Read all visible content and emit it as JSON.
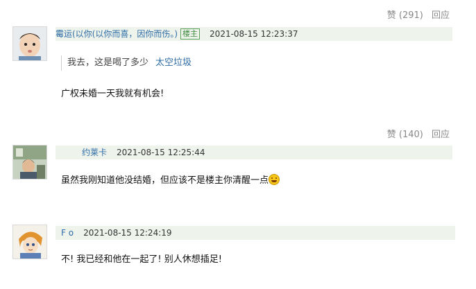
{
  "comments": [
    {
      "actions": {
        "like": "赞 (291)",
        "reply": "回应"
      },
      "user": "霉运(以你(以你而喜，因你而伤。)",
      "owner_badge": "楼主",
      "time": "2021-08-15 12:23:37",
      "quote": {
        "text": "我去，这是喝了多少",
        "author": "太空垃圾"
      },
      "content": "广权未婚一天我就有机会!"
    },
    {
      "actions": {
        "like": "赞 (140)",
        "reply": "回应"
      },
      "user": "约莱卡",
      "time": "2021-08-15 12:25:44",
      "content": "虽然我刚知道他没结婚，但应该不是楼主你清醒一点"
    },
    {
      "user": "F  o",
      "time": "2021-08-15 12:24:19",
      "content": "不! 我已经和他在一起了! 别人休想插足!"
    }
  ]
}
